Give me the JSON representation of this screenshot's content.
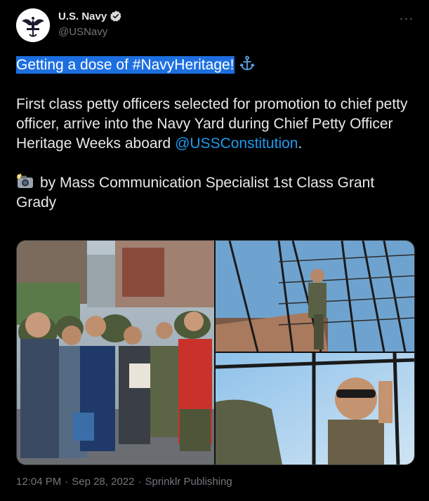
{
  "author": {
    "display_name": "U.S. Navy",
    "handle": "@USNavy",
    "verified_icon": "verified-badge-icon",
    "avatar_icon": "navy-eagle-seal"
  },
  "more_menu": {
    "icon": "more-horizontal-icon",
    "label": "···"
  },
  "tweet": {
    "headline": "Getting a dose of #NavyHeritage!",
    "line2_a": "First class petty officers selected for promotion to chief petty officer, arrive into the Navy Yard during Chief Petty Officer Heritage Weeks aboard ",
    "mention": "@USSConstitution",
    "line2_end": ".",
    "photo_credit": "by Mass Communication Specialist 1st Class Grant Grady"
  },
  "media": {
    "photos": [
      {
        "name": "sailors-walking-photo"
      },
      {
        "name": "sailor-climbing-rigging-photo"
      },
      {
        "name": "sailor-sunglasses-rigging-photo"
      }
    ]
  },
  "footer": {
    "time": "12:04 PM",
    "sep1": "·",
    "date": "Sep 28, 2022",
    "sep2": "·",
    "source": "Sprinklr Publishing"
  },
  "colors": {
    "background": "#000000",
    "text": "#e7e9ea",
    "secondary": "#71767b",
    "link": "#1d9bf0",
    "highlight": "#1d6fe0"
  }
}
